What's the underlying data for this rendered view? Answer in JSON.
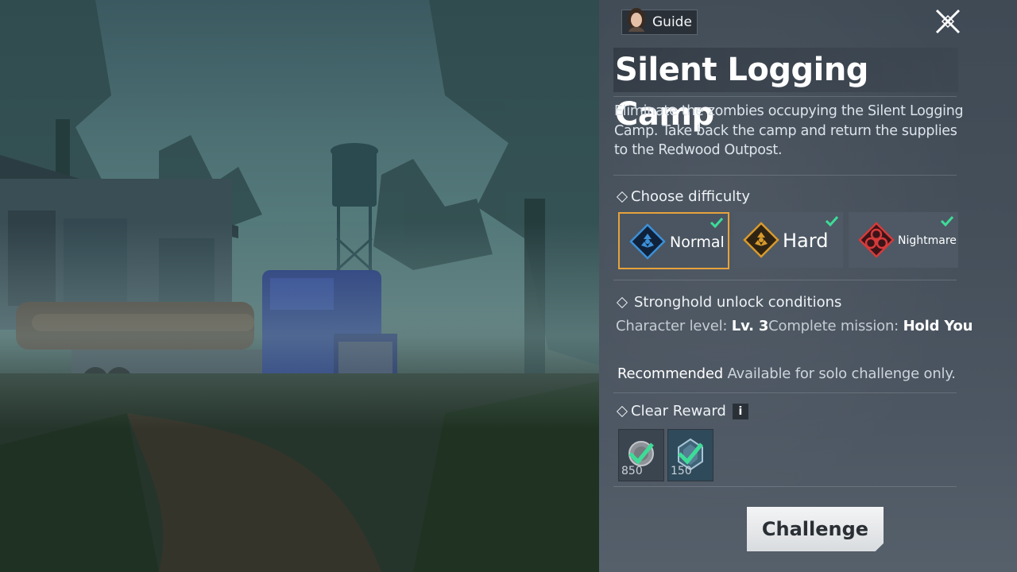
{
  "guide": {
    "label": "Guide"
  },
  "stage": {
    "title": "Silent Logging Camp",
    "description": "Eliminate the zombies occupying the Silent Logging Camp. Take back the camp and return the supplies to the Redwood Outpost."
  },
  "difficulty": {
    "heading": "Choose difficulty",
    "options": [
      {
        "label": "Normal",
        "selected": true,
        "completed": true,
        "color": "#3b8fd8"
      },
      {
        "label": "Hard",
        "selected": false,
        "completed": true,
        "color": "#d99a2b"
      },
      {
        "label": "Nightmare",
        "selected": false,
        "completed": true,
        "color": "#d63a3a"
      }
    ]
  },
  "unlock": {
    "heading": "Stronghold unlock conditions",
    "level_label": "Character level:",
    "level_value": "Lv. 3",
    "mission_label": "Complete mission:",
    "mission_value": "Hold You"
  },
  "recommended": {
    "label": "Recommended",
    "text": "Available for solo challenge only."
  },
  "rewards": {
    "heading": "Clear Reward",
    "info": "i",
    "items": [
      {
        "count": "850",
        "icon": "coin-icon",
        "claimed": true
      },
      {
        "count": "150",
        "icon": "gem-icon",
        "claimed": true
      }
    ]
  },
  "actions": {
    "challenge": "Challenge"
  },
  "colors": {
    "selected_border": "#e6a23c",
    "check": "#3ddc97"
  }
}
